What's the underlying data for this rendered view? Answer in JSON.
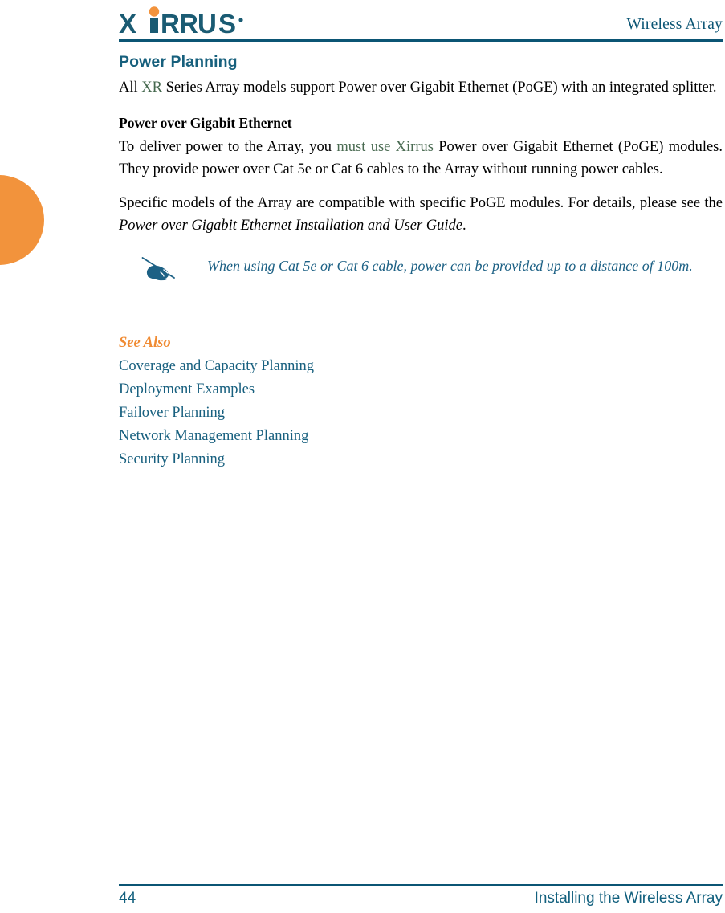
{
  "colors": {
    "brand_teal": "#0B5574",
    "heading_teal": "#17607D",
    "link_teal": "#18607F",
    "link_green": "#46694F",
    "accent_orange": "#F2933C",
    "see_also_orange": "#F08B33",
    "note_teal": "#1D6185",
    "body_text": "#000000"
  },
  "header": {
    "logo_name": "xirrus-logo",
    "logo_wordmark": "XIRRUS",
    "logo_trademark": "®",
    "title": "Wireless Array"
  },
  "edge_tab": {
    "name": "chapter-thumb-tab",
    "color": "#F2933C"
  },
  "main": {
    "section_title": "Power Planning",
    "intro_paragraph": {
      "before_link": "All ",
      "link": "XR",
      "after_link": " Series Array models support Power over Gigabit Ethernet (PoGE) with an integrated splitter."
    },
    "subsection_title": "Power over Gigabit Ethernet",
    "paragraph_2": {
      "before_link": "To deliver power to the Array, you ",
      "link": "must use Xirrus",
      "after_link": " Power over Gigabit Ethernet (PoGE) modules. They provide power over Cat 5e or Cat 6 cables to the Array without running power cables."
    },
    "paragraph_3": {
      "before_italic": "Specific models of the Array are compatible with specific PoGE modules. For details, please see the ",
      "italic": "Power over Gigabit Ethernet Installation and User Guide",
      "after_italic": "."
    },
    "note": {
      "icon_name": "writing-hand-note-icon",
      "text": "When using Cat 5e or Cat 6 cable, power can be provided up to a distance of 100m."
    },
    "see_also": {
      "label": "See Also",
      "items": [
        "Coverage and Capacity Planning",
        "Deployment Examples",
        "Failover Planning",
        "Network Management Planning",
        "Security Planning"
      ]
    }
  },
  "footer": {
    "page_number": "44",
    "title": "Installing the Wireless Array"
  }
}
